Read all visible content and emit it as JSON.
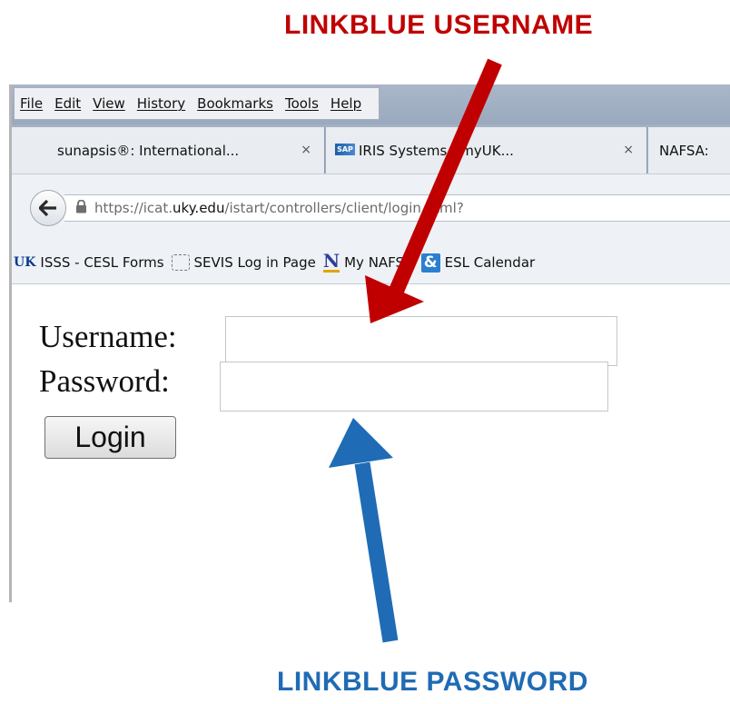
{
  "annotations": {
    "username_label": "LINKBLUE USERNAME",
    "password_label": "LINKBLUE PASSWORD",
    "username_color": "#c00000",
    "password_color": "#1f6bb5"
  },
  "menu": {
    "items": [
      "File",
      "Edit",
      "View",
      "History",
      "Bookmarks",
      "Tools",
      "Help"
    ]
  },
  "tabs": [
    {
      "title": "sunapsis®: International...",
      "close": "×"
    },
    {
      "title": "IRIS Systems - myUK...",
      "close": "×",
      "icon_text": "SAP"
    },
    {
      "title": "NAFSA:"
    }
  ],
  "address": {
    "prefix": "https://icat.",
    "domain": "uky.edu",
    "path": "/istart/controllers/client/login.html?"
  },
  "bookmarks": [
    {
      "label": "ISSS - CESL Forms",
      "icon": "uk-logo-icon",
      "icon_text": "UK"
    },
    {
      "label": "SEVIS Log in Page",
      "icon": "dashed-page-icon"
    },
    {
      "label": "My NAFSA",
      "icon": "nafsa-icon",
      "icon_text": "N"
    },
    {
      "label": "ESL Calendar",
      "icon": "ampersand-icon",
      "icon_text": "&"
    }
  ],
  "form": {
    "username_label": "Username:",
    "password_label": "Password:",
    "username_value": "",
    "password_value": "",
    "login_label": "Login"
  }
}
